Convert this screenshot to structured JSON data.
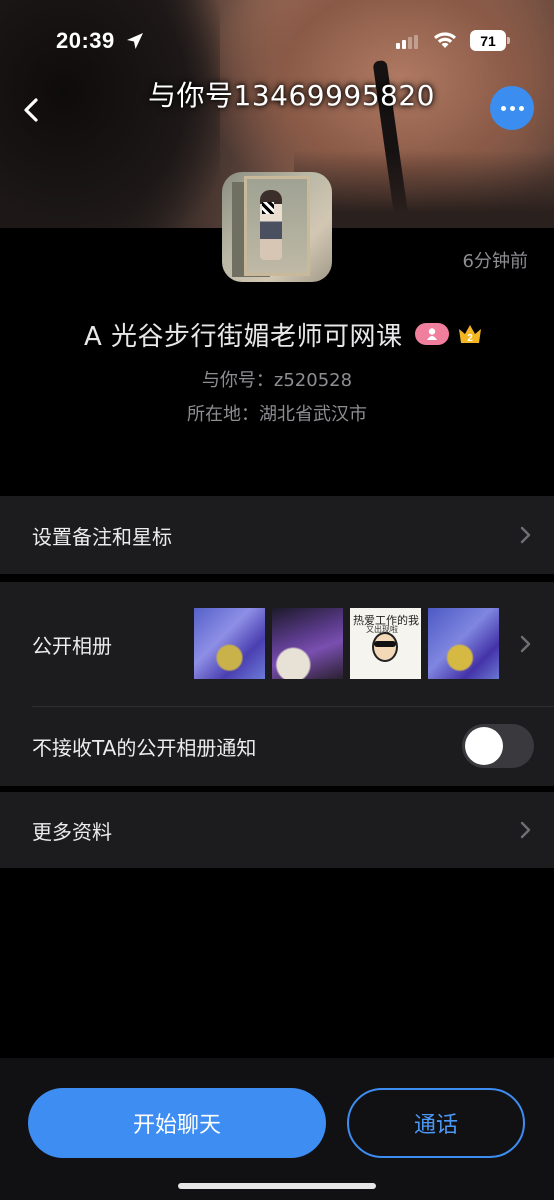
{
  "status_bar": {
    "time": "20:39",
    "battery": "71"
  },
  "header": {
    "cover_title": "与你号13469995820"
  },
  "profile": {
    "last_seen": "6分钟前",
    "nickname": "A  光谷步行街媚老师可网课",
    "account_id": "与你号：z520528",
    "location": "所在地：湖北省武汉市",
    "crown_level": "2"
  },
  "list": {
    "remark_label": "设置备注和星标",
    "album_label": "公开相册",
    "album_thumb3_top": "热爱工作的我",
    "album_thumb3_mid": "又出现啦",
    "notify_label": "不接收TA的公开相册通知",
    "notify_enabled": false,
    "more_label": "更多资料"
  },
  "bottom": {
    "chat_label": "开始聊天",
    "call_label": "通话"
  },
  "colors": {
    "accent": "#3d8df2",
    "background": "#000000",
    "panel": "#1c1c1e",
    "gender_badge": "#f07f9d",
    "secondary_text": "#8d8d92"
  }
}
